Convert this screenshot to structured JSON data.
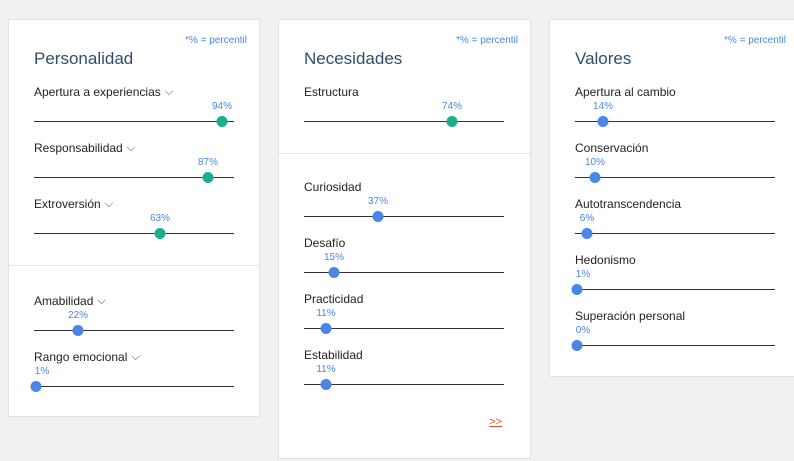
{
  "note": "*% = percentil",
  "cards": [
    {
      "title": "Personalidad",
      "groups": [
        [
          {
            "label": "Apertura a experiencias",
            "pct": "94%",
            "value": 0.94,
            "color": "#1aae8e",
            "dropdown": true
          },
          {
            "label": "Responsabilidad",
            "pct": "87%",
            "value": 0.87,
            "color": "#1aae8e",
            "dropdown": true
          },
          {
            "label": "Extroversión",
            "pct": "63%",
            "value": 0.63,
            "color": "#1aae8e",
            "dropdown": true
          }
        ],
        [
          {
            "label": "Amabilidad",
            "pct": "22%",
            "value": 0.22,
            "color": "#4a86e8",
            "dropdown": true
          },
          {
            "label": "Rango emocional",
            "pct": "1%",
            "value": 0.01,
            "color": "#4a86e8",
            "dropdown": true
          }
        ]
      ]
    },
    {
      "title": "Necesidades",
      "groups": [
        [
          {
            "label": "Estructura",
            "pct": "74%",
            "value": 0.74,
            "color": "#1aae8e",
            "dropdown": false
          }
        ],
        [
          {
            "label": "Curiosidad",
            "pct": "37%",
            "value": 0.37,
            "color": "#4a86e8",
            "dropdown": false
          },
          {
            "label": "Desafío",
            "pct": "15%",
            "value": 0.15,
            "color": "#4a86e8",
            "dropdown": false
          },
          {
            "label": "Practicidad",
            "pct": "11%",
            "value": 0.11,
            "color": "#4a86e8",
            "dropdown": false
          },
          {
            "label": "Estabilidad",
            "pct": "11%",
            "value": 0.11,
            "color": "#4a86e8",
            "dropdown": false
          }
        ]
      ],
      "more_link": ">>"
    },
    {
      "title": "Valores",
      "groups": [
        [
          {
            "label": "Apertura al cambio",
            "pct": "14%",
            "value": 0.14,
            "color": "#4a86e8",
            "dropdown": false
          },
          {
            "label": "Conservación",
            "pct": "10%",
            "value": 0.1,
            "color": "#4a86e8",
            "dropdown": false
          },
          {
            "label": "Autotranscendencia",
            "pct": "6%",
            "value": 0.06,
            "color": "#4a86e8",
            "dropdown": false
          },
          {
            "label": "Hedonismo",
            "pct": "1%",
            "value": 0.01,
            "color": "#4a86e8",
            "dropdown": false
          },
          {
            "label": "Superación personal",
            "pct": "0%",
            "value": 0.0,
            "color": "#4a86e8",
            "dropdown": false
          }
        ]
      ]
    }
  ]
}
